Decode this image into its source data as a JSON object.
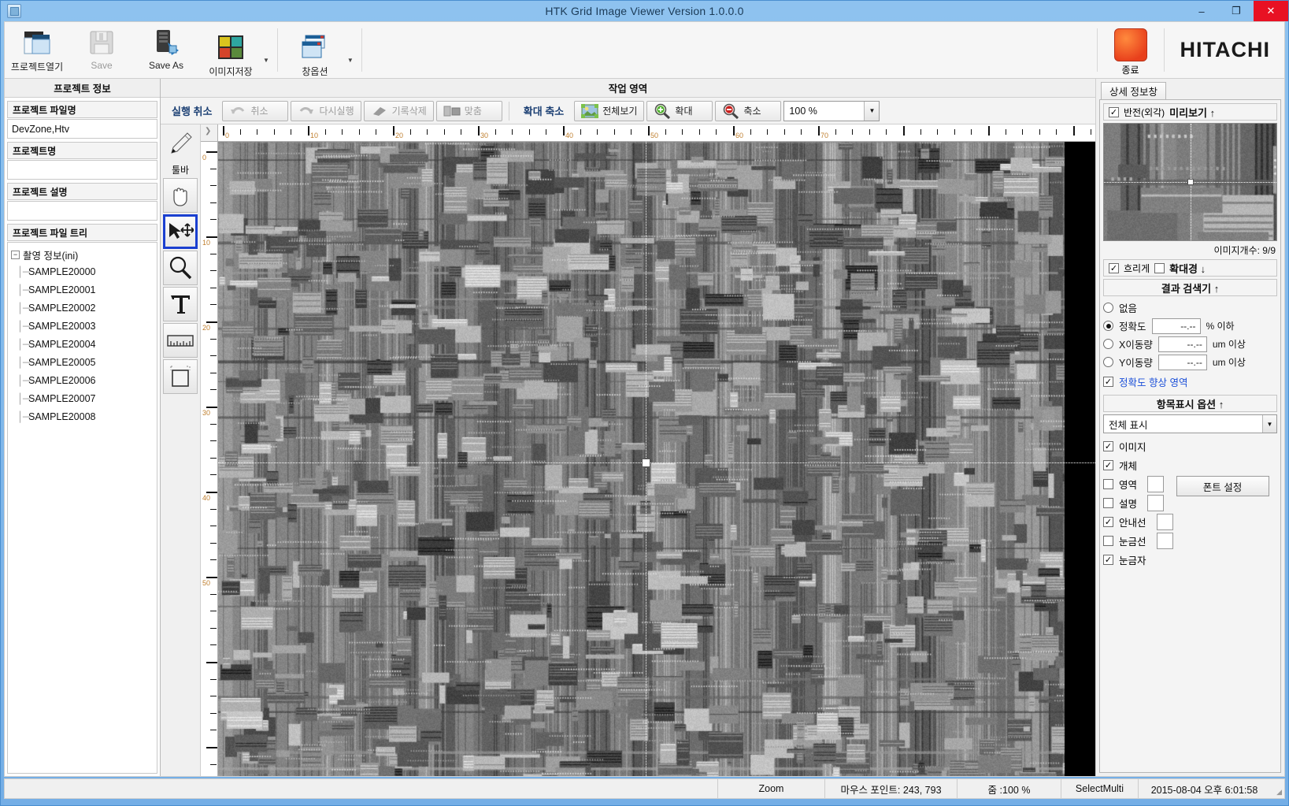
{
  "window": {
    "title": "HTK Grid Image Viewer Version 1.0.0.0",
    "icon": "app-icon",
    "minimize": "–",
    "maximize": "❐",
    "close": "✕"
  },
  "ribbon": {
    "buttons": [
      {
        "label": "프로젝트열기",
        "icon": "open-project-icon",
        "disabled": false,
        "split": false
      },
      {
        "label": "Save",
        "icon": "floppy-save-icon",
        "disabled": true,
        "split": false
      },
      {
        "label": "Save As",
        "icon": "server-save-as-icon",
        "disabled": false,
        "split": false
      },
      {
        "label": "이미지저장",
        "icon": "image-save-icon",
        "disabled": false,
        "split": true
      },
      {
        "label": "창옵션",
        "icon": "window-options-icon",
        "disabled": false,
        "split": true
      }
    ],
    "exit": {
      "label": "종료",
      "icon": "exit-icon",
      "color": "#e8401c"
    },
    "brand": "HITACHI"
  },
  "left_panel": {
    "header": "프로젝트 정보",
    "fields": [
      {
        "label": "프로젝트 파일명",
        "value": "DevZone,Htv"
      },
      {
        "label": "프로젝트명",
        "value": ""
      },
      {
        "label": "프로젝트 설명",
        "value": ""
      }
    ],
    "tree_label": "프로젝트 파일 트리",
    "tree_root": "촬영 정보(ini)",
    "tree_toggle": "−",
    "tree_items": [
      "SAMPLE20000",
      "SAMPLE20001",
      "SAMPLE20002",
      "SAMPLE20003",
      "SAMPLE20004",
      "SAMPLE20005",
      "SAMPLE20006",
      "SAMPLE20007",
      "SAMPLE20008"
    ]
  },
  "work_area": {
    "header": "작업 영역",
    "history_group_title": "실행 취소",
    "buttons": [
      {
        "label": "취소",
        "icon": "undo-arrow-icon",
        "disabled": true
      },
      {
        "label": "다시실행",
        "icon": "redo-arrow-icon",
        "disabled": true
      },
      {
        "label": "기록삭제",
        "icon": "eraser-icon",
        "disabled": true
      },
      {
        "label": "맞춤",
        "icon": "fit-icon",
        "disabled": true
      }
    ],
    "zoom_group_title": "확대 축소",
    "zoom_buttons": [
      {
        "label": "전체보기",
        "icon": "fit-to-screen-icon"
      },
      {
        "label": "확대",
        "icon": "zoom-in-icon"
      },
      {
        "label": "축소",
        "icon": "zoom-out-icon"
      }
    ],
    "zoom_value": "100 %",
    "zoom_options": [
      "100 %"
    ]
  },
  "tool_palette": {
    "label": "툴바",
    "tools": [
      {
        "name": "pen-tool",
        "selected": false
      },
      {
        "name": "hand-pan-tool",
        "selected": false
      },
      {
        "name": "select-move-tool",
        "selected": true
      },
      {
        "name": "magnifier-tool",
        "selected": false
      },
      {
        "name": "text-tool",
        "selected": false
      },
      {
        "name": "ruler-measure-tool",
        "selected": false
      },
      {
        "name": "rectangle-region-tool",
        "selected": false
      }
    ]
  },
  "rulers": {
    "h_labels": [
      "0",
      "10",
      "20",
      "30",
      "40",
      "50",
      "60",
      "70"
    ],
    "v_labels": [
      "0",
      "10",
      "20",
      "30",
      "40",
      "50"
    ]
  },
  "right_panel": {
    "tab": "상세 정보창",
    "preview": {
      "invert_label": "반전(외각)",
      "invert_checked": true,
      "title": "미리보기 ↑",
      "count_label": "이미지개수: 9/9"
    },
    "magnifier": {
      "blur_label": "흐리게",
      "blur_checked": true,
      "second_checked": false,
      "title": "확대경 ↓"
    },
    "result_finder": {
      "title": "결과 검색기 ↑",
      "options": [
        {
          "label": "없음",
          "selected": false,
          "value": null,
          "unit": ""
        },
        {
          "label": "정확도",
          "selected": true,
          "value": "--.--",
          "unit": "% 이하"
        },
        {
          "label": "X이동량",
          "selected": false,
          "value": "--.--",
          "unit": "um 이상"
        },
        {
          "label": "Y이동량",
          "selected": false,
          "value": "--.--",
          "unit": "um 이상"
        }
      ],
      "enhance_label": "정확도 향상 영역",
      "enhance_checked": true,
      "enhance_color": "#1b4fd8"
    },
    "display_options": {
      "title": "항목표시 옵션 ↑",
      "mode_value": "전체 표시",
      "mode_options": [
        "전체 표시"
      ],
      "items": [
        {
          "label": "이미지",
          "checked": true,
          "swatch": false
        },
        {
          "label": "개체",
          "checked": true,
          "swatch": false
        },
        {
          "label": "영역",
          "checked": false,
          "swatch": true
        },
        {
          "label": "설명",
          "checked": false,
          "swatch": true
        },
        {
          "label": "안내선",
          "checked": true,
          "swatch": true
        },
        {
          "label": "눈금선",
          "checked": false,
          "swatch": true
        },
        {
          "label": "눈금자",
          "checked": true,
          "swatch": false
        }
      ],
      "font_button": "폰트 설정"
    }
  },
  "statusbar": {
    "zoom_cell": "Zoom",
    "mouse_point": "마우스 포인트: 243, 793",
    "zoom_level": "줌 :100 %",
    "mode": "SelectMulti",
    "timestamp": "2015-08-04 오후 6:01:58"
  }
}
